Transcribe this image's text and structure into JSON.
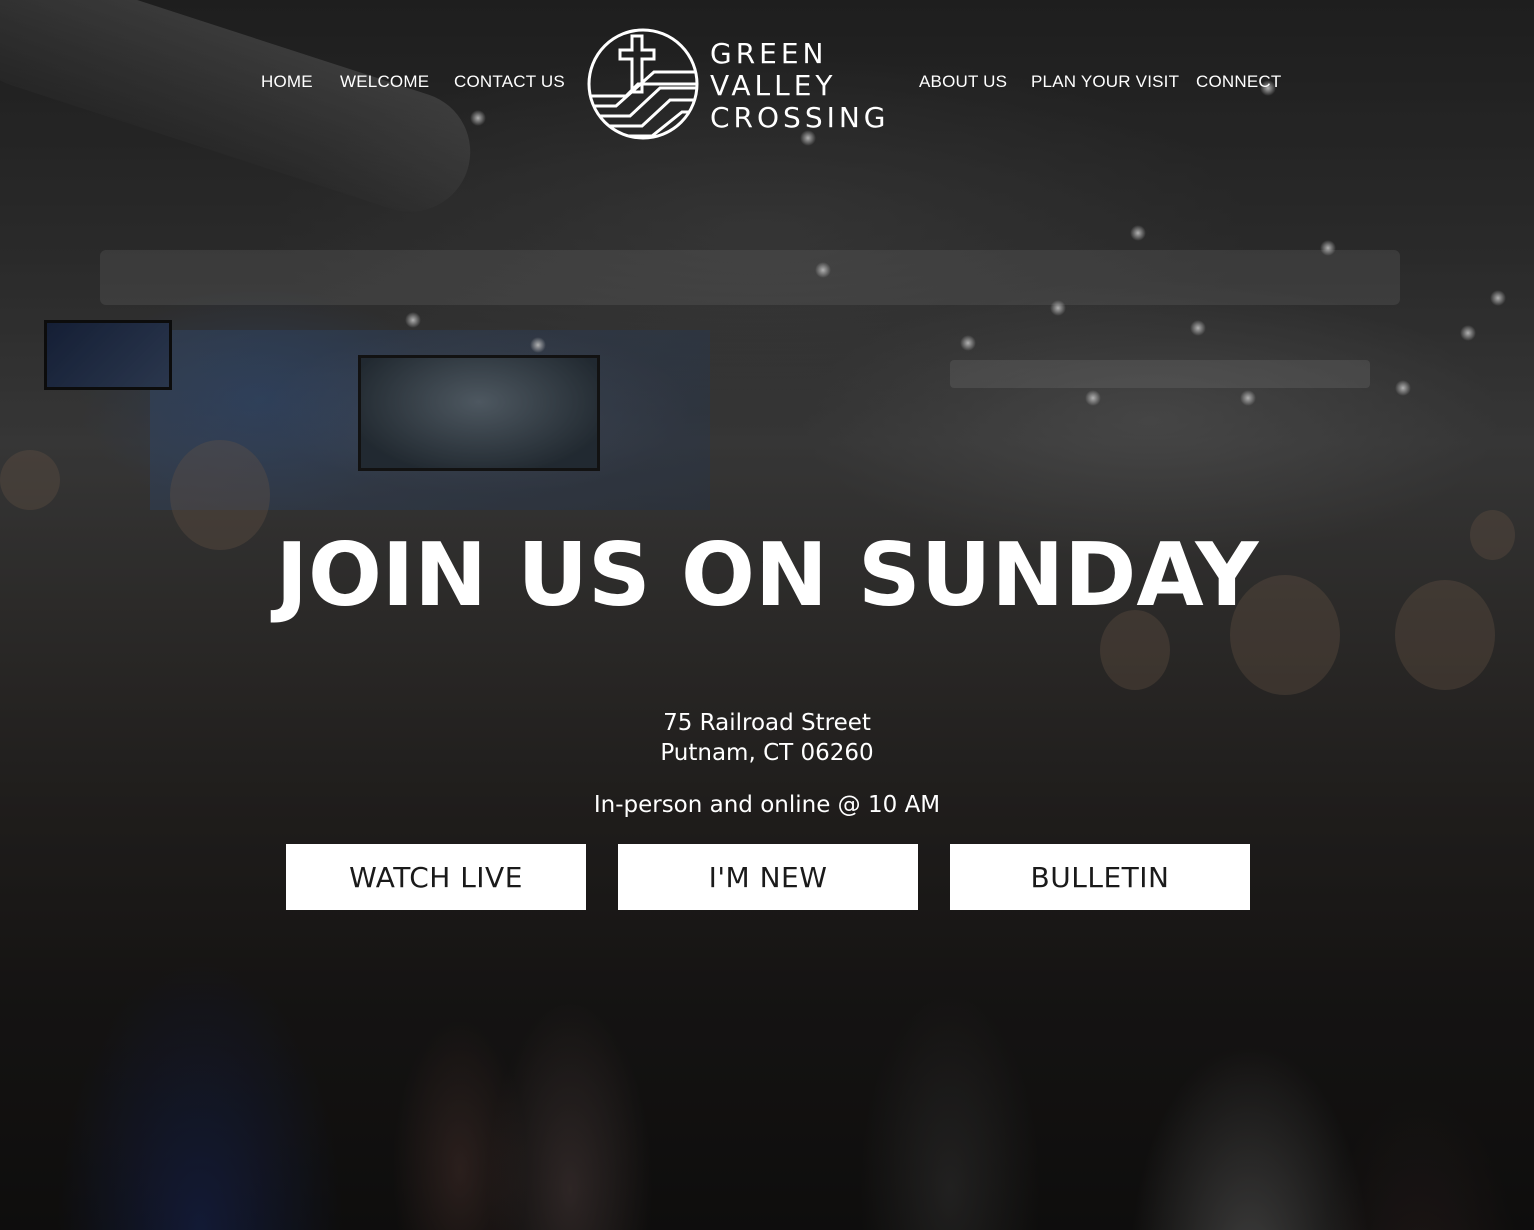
{
  "nav": {
    "left_items": [
      {
        "label": "HOME"
      },
      {
        "label": "WELCOME"
      },
      {
        "label": "CONTACT US"
      }
    ],
    "right_items": [
      {
        "label": "ABOUT US"
      },
      {
        "label": "PLAN YOUR VISIT"
      },
      {
        "label": "CONNECT"
      }
    ],
    "logo": {
      "icon": "cross-circle-logo-icon",
      "lines": [
        "GREEN",
        "VALLEY",
        "CROSSING"
      ]
    }
  },
  "hero": {
    "headline": "JOIN US ON SUNDAY",
    "address_line1": "75 Railroad Street",
    "address_line2": "Putnam, CT 06260",
    "service_times": "In-person and online @ 10 AM",
    "buttons": [
      {
        "label": "WATCH LIVE"
      },
      {
        "label": "I'M NEW"
      },
      {
        "label": "BULLETIN"
      }
    ]
  },
  "colors": {
    "text": "#ffffff",
    "button_bg": "#ffffff",
    "button_text": "#1a1a1a"
  }
}
